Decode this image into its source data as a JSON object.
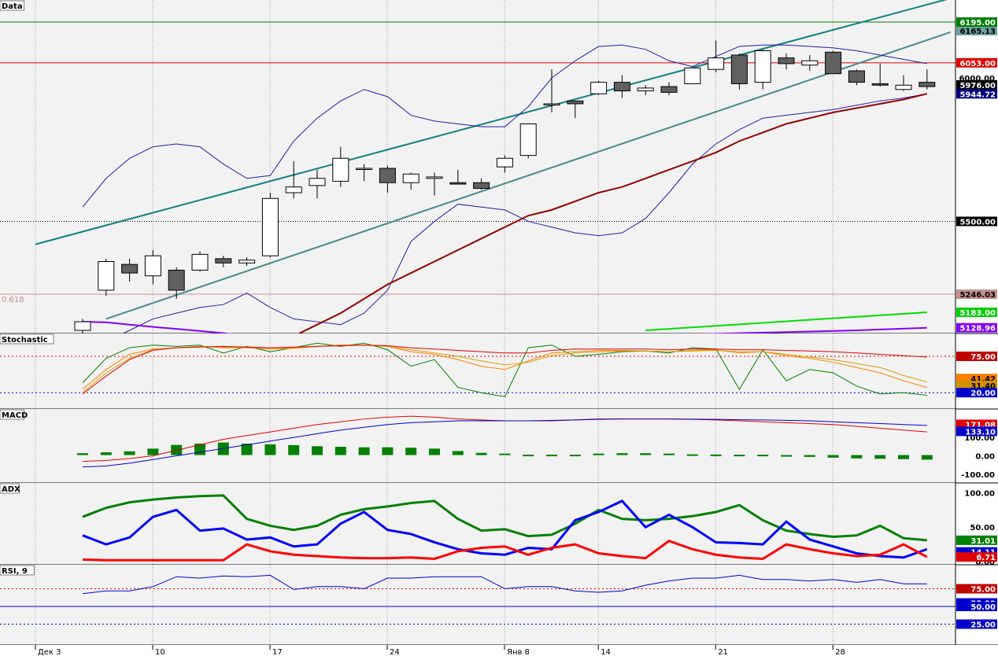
{
  "chart_data": [
    {
      "pane": "Data",
      "type": "candlestick",
      "title": "Data",
      "ylim": [
        5120,
        6250
      ],
      "candles": [
        {
          "o": 5120,
          "h": 5160,
          "l": 5080,
          "c": 5150
        },
        {
          "o": 5260,
          "h": 5370,
          "l": 5240,
          "c": 5360
        },
        {
          "o": 5350,
          "h": 5370,
          "l": 5290,
          "c": 5320
        },
        {
          "o": 5310,
          "h": 5400,
          "l": 5280,
          "c": 5380
        },
        {
          "o": 5330,
          "h": 5340,
          "l": 5230,
          "c": 5260
        },
        {
          "o": 5330,
          "h": 5395,
          "l": 5325,
          "c": 5385
        },
        {
          "o": 5370,
          "h": 5380,
          "l": 5340,
          "c": 5355
        },
        {
          "o": 5355,
          "h": 5375,
          "l": 5345,
          "c": 5365
        },
        {
          "o": 5380,
          "h": 5600,
          "l": 5375,
          "c": 5580
        },
        {
          "o": 5600,
          "h": 5710,
          "l": 5580,
          "c": 5620
        },
        {
          "o": 5625,
          "h": 5680,
          "l": 5580,
          "c": 5650
        },
        {
          "o": 5640,
          "h": 5760,
          "l": 5620,
          "c": 5720
        },
        {
          "o": 5685,
          "h": 5700,
          "l": 5640,
          "c": 5685
        },
        {
          "o": 5685,
          "h": 5695,
          "l": 5600,
          "c": 5635
        },
        {
          "o": 5635,
          "h": 5670,
          "l": 5610,
          "c": 5665
        },
        {
          "o": 5650,
          "h": 5670,
          "l": 5590,
          "c": 5655
        },
        {
          "o": 5635,
          "h": 5680,
          "l": 5630,
          "c": 5630
        },
        {
          "o": 5635,
          "h": 5650,
          "l": 5610,
          "c": 5615
        },
        {
          "o": 5690,
          "h": 5730,
          "l": 5670,
          "c": 5720
        },
        {
          "o": 5730,
          "h": 5840,
          "l": 5720,
          "c": 5840
        },
        {
          "o": 5910,
          "h": 6030,
          "l": 5880,
          "c": 5910
        },
        {
          "o": 5920,
          "h": 5920,
          "l": 5860,
          "c": 5910
        },
        {
          "o": 5945,
          "h": 5990,
          "l": 5940,
          "c": 5985
        },
        {
          "o": 5985,
          "h": 6010,
          "l": 5930,
          "c": 5955
        },
        {
          "o": 5955,
          "h": 5975,
          "l": 5940,
          "c": 5965
        },
        {
          "o": 5970,
          "h": 5985,
          "l": 5940,
          "c": 5950
        },
        {
          "o": 5980,
          "h": 6035,
          "l": 5980,
          "c": 6035
        },
        {
          "o": 6030,
          "h": 6130,
          "l": 6020,
          "c": 6070
        },
        {
          "o": 6080,
          "h": 6085,
          "l": 5960,
          "c": 5980
        },
        {
          "o": 5985,
          "h": 6100,
          "l": 5960,
          "c": 6095
        },
        {
          "o": 6070,
          "h": 6085,
          "l": 6030,
          "c": 6050
        },
        {
          "o": 6045,
          "h": 6080,
          "l": 6025,
          "c": 6060
        },
        {
          "o": 6090,
          "h": 6095,
          "l": 6015,
          "c": 6015
        },
        {
          "o": 6025,
          "h": 6030,
          "l": 5975,
          "c": 5985
        },
        {
          "o": 5980,
          "h": 6050,
          "l": 5970,
          "c": 5975
        },
        {
          "o": 5960,
          "h": 6010,
          "l": 5955,
          "c": 5975
        },
        {
          "o": 5985,
          "h": 6030,
          "l": 5960,
          "c": 5970
        }
      ],
      "bands": {
        "upper": [
          5550,
          5650,
          5720,
          5760,
          5770,
          5760,
          5700,
          5650,
          5660,
          5780,
          5860,
          5920,
          5960,
          5935,
          5870,
          5850,
          5840,
          5830,
          5830,
          5900,
          6000,
          6060,
          6110,
          6115,
          6100,
          6060,
          6040,
          6075,
          6110,
          6115,
          6115,
          6110,
          6105,
          6095,
          6080,
          6065,
          6050
        ],
        "middle": [
          5300,
          5340,
          5370,
          5400,
          5420,
          5440,
          5455,
          5465,
          5480,
          5500,
          5520,
          5540,
          5560,
          5575,
          5585,
          5590,
          5590,
          5595,
          5605,
          5625,
          5650,
          5680,
          5710,
          5735,
          5760,
          5790,
          5825,
          5865,
          5900,
          5930,
          5950,
          5965,
          5975,
          5985,
          5990,
          5995,
          6000
        ],
        "lower": [
          5050,
          5080,
          5120,
          5160,
          5180,
          5200,
          5210,
          5250,
          5200,
          5160,
          5150,
          5140,
          5180,
          5260,
          5430,
          5500,
          5560,
          5550,
          5540,
          5500,
          5480,
          5460,
          5450,
          5460,
          5510,
          5600,
          5700,
          5770,
          5820,
          5860,
          5870,
          5880,
          5890,
          5905,
          5920,
          5930,
          5945
        ]
      },
      "channel_upper": {
        "x": [
          0,
          36
        ],
        "y": [
          5420,
          6300
        ]
      },
      "channel_lower": {
        "x": [
          1,
          36
        ],
        "y": [
          5160,
          6160
        ]
      },
      "ma_red": [
        4960,
        4970,
        4980,
        4990,
        5000,
        5010,
        5020,
        5030,
        5060,
        5100,
        5140,
        5180,
        5230,
        5280,
        5320,
        5360,
        5400,
        5440,
        5480,
        5520,
        5540,
        5570,
        5600,
        5620,
        5650,
        5680,
        5710,
        5740,
        5780,
        5810,
        5840,
        5860,
        5880,
        5895,
        5910,
        5925,
        5945
      ],
      "ma_green": {
        "x": [
          24,
          36
        ],
        "y": [
          5120,
          5183
        ]
      },
      "ma_purple": [
        5150,
        5148,
        5140,
        5132,
        5125,
        5118,
        5110,
        5100,
        5095,
        5090,
        5085,
        5080,
        5078,
        5075,
        5072,
        5070,
        5072,
        5075,
        5078,
        5080,
        5085,
        5090,
        5095,
        5098,
        5100,
        5102,
        5105,
        5108,
        5110,
        5112,
        5114,
        5116,
        5118,
        5120,
        5123,
        5126,
        5129
      ],
      "hlines": [
        {
          "value": 6195,
          "label": "6195.00",
          "color": "#008000"
        },
        {
          "value": 6053,
          "label": "6053.00",
          "color": "#e00000"
        },
        {
          "value": 5500,
          "label": "5500.00",
          "color": "#000000",
          "dotted": true
        },
        {
          "value": 5246,
          "label": "5246.03",
          "color": "#d09090"
        }
      ],
      "fib_label": "0.618",
      "axis_badges": [
        {
          "value": 6165.13,
          "label": "6165.13",
          "bg": "#6f9f9f",
          "fg": "#000"
        },
        {
          "value": 6053,
          "label": "6053.00",
          "bg": "#e00000",
          "fg": "#fff"
        },
        {
          "value": 5976,
          "label": "5976.00",
          "bg": "#000000",
          "fg": "#fff"
        },
        {
          "value": 5944.72,
          "label": "5944.72",
          "bg": "#000080",
          "fg": "#fff"
        },
        {
          "value": 6195,
          "label": "6195.00",
          "bg": "#008000",
          "fg": "#fff"
        },
        {
          "value": 5500,
          "label": "5500.00",
          "bg": "#000000",
          "fg": "#fff"
        },
        {
          "value": 5246.03,
          "label": "5246.03",
          "bg": "#c49090",
          "fg": "#000"
        },
        {
          "value": 5183,
          "label": "5183.00",
          "bg": "#00cc00",
          "fg": "#fff"
        },
        {
          "value": 5128.96,
          "label": "5128.96",
          "bg": "#8000ff",
          "fg": "#fff"
        }
      ],
      "axis_ticks": [
        {
          "value": 6000,
          "label": "6000.00"
        }
      ]
    },
    {
      "pane": "Stochastic",
      "type": "line",
      "title": "Stochastic",
      "ylim": [
        0,
        100
      ],
      "series": [
        {
          "color": "#008000",
          "values": [
            35,
            72,
            88,
            92,
            90,
            92,
            80,
            90,
            82,
            88,
            95,
            90,
            95,
            85,
            60,
            70,
            28,
            20,
            14,
            88,
            92,
            75,
            78,
            82,
            83,
            80,
            88,
            86,
            25,
            85,
            38,
            55,
            50,
            30,
            18,
            20,
            16
          ]
        },
        {
          "color": "#ff8000",
          "values": [
            25,
            55,
            78,
            86,
            88,
            90,
            88,
            88,
            86,
            87,
            90,
            92,
            92,
            90,
            82,
            78,
            70,
            60,
            55,
            68,
            80,
            82,
            84,
            84,
            83,
            82,
            84,
            85,
            80,
            82,
            76,
            72,
            66,
            58,
            50,
            38,
            28
          ]
        },
        {
          "color": "#d4a000",
          "values": [
            20,
            50,
            72,
            85,
            88,
            90,
            89,
            89,
            88,
            88,
            90,
            91,
            92,
            90,
            85,
            80,
            75,
            68,
            62,
            66,
            76,
            80,
            82,
            83,
            83,
            82,
            83,
            84,
            82,
            82,
            78,
            74,
            70,
            64,
            58,
            46,
            36
          ]
        },
        {
          "color": "#e00000",
          "values": [
            18,
            45,
            70,
            84,
            88,
            89,
            90,
            89,
            88,
            89,
            90,
            91,
            92,
            91,
            88,
            86,
            84,
            82,
            80,
            80,
            84,
            86,
            86,
            86,
            86,
            85,
            86,
            86,
            85,
            85,
            84,
            83,
            82,
            80,
            78,
            76,
            74
          ]
        }
      ],
      "hlines": [
        {
          "value": 75,
          "color": "#e00000"
        },
        {
          "value": 20,
          "color": "#0000cc"
        }
      ],
      "axis_badges": [
        {
          "value": 75,
          "label": "75.00",
          "bg": "#c00000",
          "fg": "#fff"
        },
        {
          "value": 41.42,
          "label": "41.42",
          "bg": "#ff8000",
          "fg": "#000"
        },
        {
          "value": 31,
          "label": "31.40",
          "bg": "#d09000",
          "fg": "#000"
        },
        {
          "value": 20,
          "label": "20.00",
          "bg": "#0000cc",
          "fg": "#fff"
        }
      ]
    },
    {
      "pane": "MACD",
      "type": "bar",
      "title": "MACD",
      "ylim": [
        -130,
        220
      ],
      "histogram": [
        10,
        15,
        20,
        35,
        55,
        62,
        68,
        62,
        58,
        54,
        48,
        45,
        42,
        42,
        40,
        35,
        22,
        12,
        8,
        2,
        2,
        2,
        8,
        10,
        10,
        8,
        4,
        3,
        2,
        2,
        -6,
        -10,
        -14,
        -18,
        -20,
        -22,
        -25
      ],
      "macd_line": [
        -30,
        -25,
        -15,
        0,
        30,
        60,
        90,
        110,
        130,
        150,
        170,
        185,
        200,
        210,
        215,
        210,
        200,
        195,
        190,
        190,
        190,
        195,
        200,
        200,
        200,
        200,
        198,
        195,
        190,
        185,
        180,
        175,
        170,
        160,
        150,
        140,
        130
      ],
      "signal_line": [
        -60,
        -55,
        -40,
        -20,
        0,
        20,
        40,
        60,
        80,
        100,
        120,
        140,
        155,
        170,
        180,
        185,
        190,
        190,
        190,
        190,
        192,
        195,
        198,
        200,
        200,
        200,
        199,
        198,
        196,
        195,
        193,
        190,
        185,
        180,
        175,
        170,
        165
      ],
      "axis_badges": [
        {
          "value": 171.08,
          "label": "171.08",
          "bg": "#e00000",
          "fg": "#fff"
        },
        {
          "value": 133,
          "label": "133.10",
          "bg": "#0000cc",
          "fg": "#fff"
        }
      ],
      "axis_ticks": [
        {
          "value": 100,
          "label": "100.00"
        },
        {
          "value": 0,
          "label": "0.00"
        },
        {
          "value": -100,
          "label": "-100.00"
        }
      ]
    },
    {
      "pane": "ADX",
      "type": "line",
      "title": "ADX",
      "ylim": [
        0,
        105
      ],
      "series": [
        {
          "color": "#008000",
          "values": [
            65,
            78,
            86,
            90,
            93,
            95,
            96,
            62,
            52,
            46,
            52,
            68,
            76,
            80,
            85,
            88,
            62,
            45,
            47,
            37,
            39,
            55,
            75,
            62,
            60,
            62,
            66,
            72,
            82,
            60,
            45,
            40,
            36,
            38,
            52,
            34,
            31
          ]
        },
        {
          "color": "#0000ff",
          "values": [
            38,
            25,
            35,
            65,
            75,
            45,
            48,
            32,
            35,
            22,
            25,
            55,
            72,
            46,
            40,
            28,
            18,
            12,
            10,
            20,
            18,
            60,
            72,
            88,
            50,
            68,
            50,
            28,
            27,
            25,
            58,
            32,
            22,
            12,
            8,
            6,
            18
          ]
        },
        {
          "color": "#ff0000",
          "values": [
            3,
            2,
            2,
            2,
            2,
            2,
            2,
            25,
            15,
            10,
            8,
            6,
            5,
            5,
            6,
            4,
            15,
            20,
            22,
            10,
            20,
            25,
            12,
            8,
            5,
            30,
            18,
            10,
            6,
            4,
            25,
            18,
            12,
            8,
            10,
            25,
            6.71
          ]
        }
      ],
      "axis_badges": [
        {
          "value": 31.01,
          "label": "31.01",
          "bg": "#008000",
          "fg": "#fff"
        },
        {
          "value": 14.11,
          "label": "14.11",
          "bg": "#0000cc",
          "fg": "#fff"
        },
        {
          "value": 6.71,
          "label": "6.71",
          "bg": "#e00000",
          "fg": "#fff"
        }
      ],
      "axis_ticks": [
        {
          "value": 100,
          "label": "100.00"
        },
        {
          "value": 50,
          "label": "50.00"
        },
        {
          "value": 0,
          "label": "0.00"
        }
      ]
    },
    {
      "pane": "RSI",
      "type": "line",
      "title": "RSI, 9",
      "ylim": [
        0,
        100
      ],
      "series": [
        {
          "color": "#0000cc",
          "values": [
            68,
            72,
            72,
            78,
            92,
            90,
            93,
            92,
            94,
            74,
            78,
            78,
            75,
            90,
            90,
            92,
            92,
            92,
            75,
            78,
            78,
            72,
            70,
            72,
            80,
            86,
            90,
            90,
            94,
            88,
            88,
            86,
            88,
            84,
            88,
            82,
            82
          ]
        }
      ],
      "hlines": [
        {
          "value": 75,
          "color": "#e00000"
        },
        {
          "value": 50,
          "color": "#0000cc",
          "solid": true
        },
        {
          "value": 25,
          "color": "#0000cc"
        }
      ],
      "axis_badges": [
        {
          "value": 75,
          "label": "75.00",
          "bg": "#c00000",
          "fg": "#fff"
        },
        {
          "value": 55,
          "label": "55.22",
          "bg": "#0000cc",
          "fg": "#fff"
        },
        {
          "value": 50,
          "label": "50.00",
          "bg": "#0000cc",
          "fg": "#fff"
        },
        {
          "value": 25,
          "label": "25.00",
          "bg": "#0000cc",
          "fg": "#fff"
        }
      ]
    }
  ],
  "x_axis": {
    "labels": [
      {
        "index": 0,
        "label": "Дек 3"
      },
      {
        "index": 5,
        "label": "10"
      },
      {
        "index": 10,
        "label": "17"
      },
      {
        "index": 15,
        "label": "24"
      },
      {
        "index": 20,
        "label": "Янв 8"
      },
      {
        "index": 24,
        "label": "14"
      },
      {
        "index": 29,
        "label": "21"
      },
      {
        "index": 34,
        "label": "28"
      }
    ]
  }
}
